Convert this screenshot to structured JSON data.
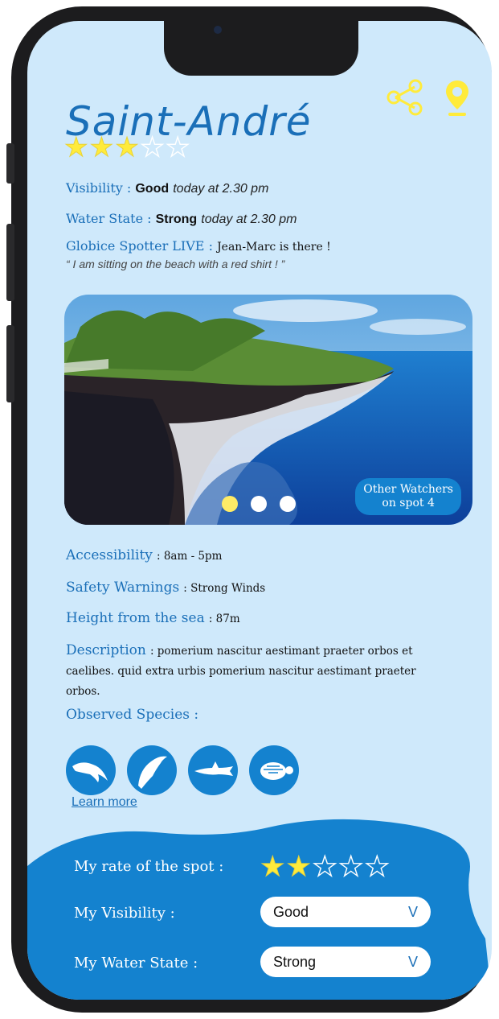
{
  "spot": {
    "name": "Saint-André",
    "rating": 3,
    "rating_max": 5
  },
  "conditions": {
    "visibility_label": "Visibility :",
    "visibility_value": "Good",
    "visibility_time": "today at 2.30 pm",
    "water_label": "Water State :",
    "water_value": "Strong",
    "water_time": "today at 2.30 pm",
    "spotter_label": "Globice Spotter LIVE :",
    "spotter_value": "Jean-Marc is there !",
    "spotter_quote": "“ I am sitting on the beach with a red shirt ! ”"
  },
  "carousel": {
    "watchers_line1": "Other Watchers",
    "watchers_line2": "on spot 4",
    "slides": 3,
    "active_slide": 1
  },
  "details": {
    "accessibility_label": "Accessibility",
    "accessibility_value": ": 8am - 5pm",
    "safety_label": "Safety Warnings",
    "safety_value": ": Strong Winds",
    "height_label": "Height from the sea",
    "height_value": ": 87m",
    "description_label": "Description",
    "description_value": ": pomerium nascitur aestimant praeter orbos et caelibes. quid extra urbis pomerium nascitur aestimant praeter orbos."
  },
  "species": {
    "label": "Observed Species :",
    "items": [
      "dolphin-icon",
      "jumping-dolphin-icon",
      "shark-icon",
      "turtle-icon"
    ],
    "learn_more": "Learn more"
  },
  "my_report": {
    "rate_label": "My rate of the spot :",
    "rate_value": 2,
    "rate_max": 5,
    "visibility_label": "My Visibility :",
    "visibility_value": "Good",
    "water_label": "My Water State :",
    "water_value": "Strong",
    "chevron": "V"
  },
  "colors": {
    "accent": "#1482cf",
    "title": "#1a6fb8",
    "background": "#cfe9fb",
    "star": "#ffeb3b"
  }
}
